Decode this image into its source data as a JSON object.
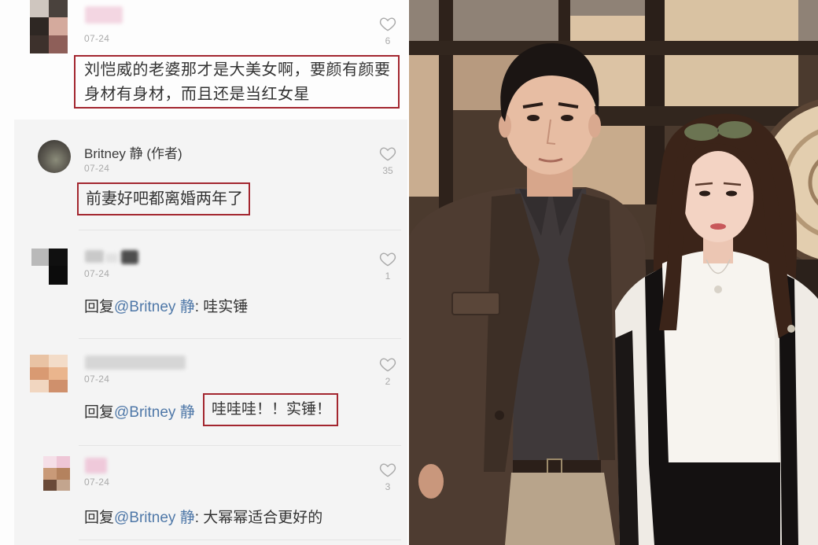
{
  "comments": [
    {
      "date": "07-24",
      "likes": "6",
      "lines": [
        "刘恺威的老婆那才是大美女啊，要颜有颜要",
        "身材有身材，而且还是当红女星"
      ]
    },
    {
      "name": "Britney 静 (作者)",
      "date": "07-24",
      "likes": "35",
      "text": "前妻好吧都离婚两年了"
    },
    {
      "date": "07-24",
      "likes": "1",
      "reply_prefix": "回复",
      "mention": "@Britney 静",
      "text": ": 哇实锤"
    },
    {
      "date": "07-24",
      "likes": "2",
      "reply_prefix": "回复",
      "mention": "@Britney 静",
      "text": "哇哇哇！！实锤！"
    },
    {
      "date": "07-24",
      "likes": "3",
      "reply_prefix": "回复",
      "mention": "@Britney 静",
      "text": ": 大幂幂适合更好的"
    }
  ],
  "icons": {
    "like": "heart-outline-icon"
  },
  "colors": {
    "highlight_border": "#a3262f",
    "mention": "#4f78a8",
    "text": "#333333",
    "meta": "#aaaaaa"
  }
}
